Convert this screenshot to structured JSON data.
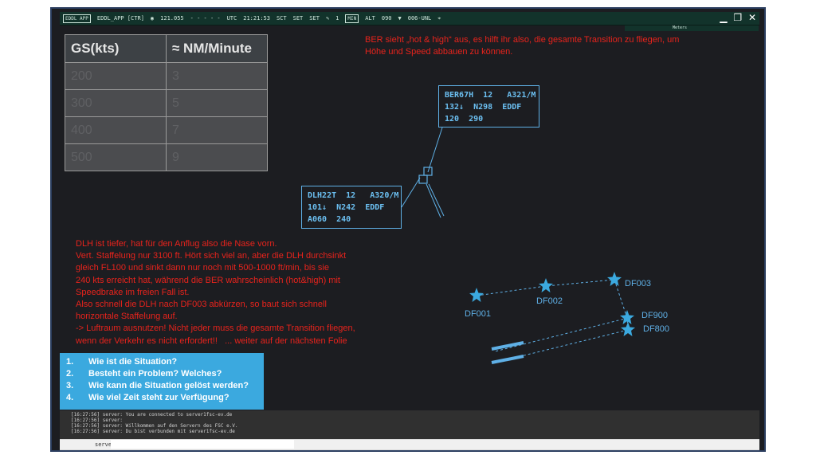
{
  "toolbar": {
    "logo": "EDDL APP",
    "position": "EDDL_APP [CTR]",
    "frequency": "121.055",
    "time_label": "UTC",
    "time": "21:21:53",
    "sct": "SCT",
    "set1": "SET",
    "set2": "SET",
    "range": "1",
    "min_label": "MIN",
    "alt_label": "ALT",
    "heading": "090",
    "transition": "006-UNL",
    "subbar": "Meters"
  },
  "table": {
    "headers": [
      "GS(kts)",
      "≈ NM/Minute"
    ],
    "rows": [
      [
        "200",
        "3"
      ],
      [
        "300",
        "5"
      ],
      [
        "400",
        "7"
      ],
      [
        "500",
        "9"
      ]
    ]
  },
  "notes": {
    "ber": "BER sieht „hot & high“ aus, es hilft ihr also, die gesamte Transition zu fliegen, um\nHöhe und Speed abbauen zu können.",
    "dlh": "DLH ist tiefer, hat für den Anflug also die Nase vorn.\nVert. Staffelung nur 3100 ft. Hört sich viel an, aber die DLH durchsinkt\ngleich FL100 und sinkt dann nur noch mit 500-1000 ft/min, bis sie\n240 kts erreicht hat, während die BER wahrscheinlich (hot&high) mit\nSpeedbrake im freien Fall ist.\nAlso schnell die DLH nach DF003 abkürzen, so baut sich schnell\nhorizontale Staffelung auf.\n-> Luftraum ausnutzen! Nicht jeder muss die gesamte Transition fliegen,\nwenn der Verkehr es nicht erfordert!!   ... weiter auf der nächsten Folie"
  },
  "tags": {
    "ber": "BER67H  12   A321/M\n132↓  N298  EDDF\n120  290",
    "dlh": "DLH22T  12   A320/M\n101↓  N242  EDDF\nA060  240"
  },
  "fixes": [
    "DF001",
    "DF002",
    "DF003",
    "DF900",
    "DF800"
  ],
  "questions": [
    {
      "num": "1.",
      "text": "Wie ist die Situation?"
    },
    {
      "num": "2.",
      "text": "Besteht ein Problem? Welches?"
    },
    {
      "num": "3.",
      "text": "Wie kann die Situation gelöst werden?"
    },
    {
      "num": "4.",
      "text": "Wie viel Zeit steht zur Verfügung?"
    }
  ],
  "console": {
    "lines": [
      "[16:27:56] server: You are connected to server1fsc-ev.de",
      "[16:27:56] server:",
      "[16:27:56] server: Willkommen auf den Servern des FSC e.V.",
      "[16:27:56] server: Du bist verbunden mit server1fsc-ev.de"
    ],
    "prefix": "server",
    "input_value": ""
  },
  "colors": {
    "scope_bg": "#1c1d21",
    "route": "#5fb0e6",
    "note": "#e8231c",
    "question_bg": "#3ba9df"
  }
}
